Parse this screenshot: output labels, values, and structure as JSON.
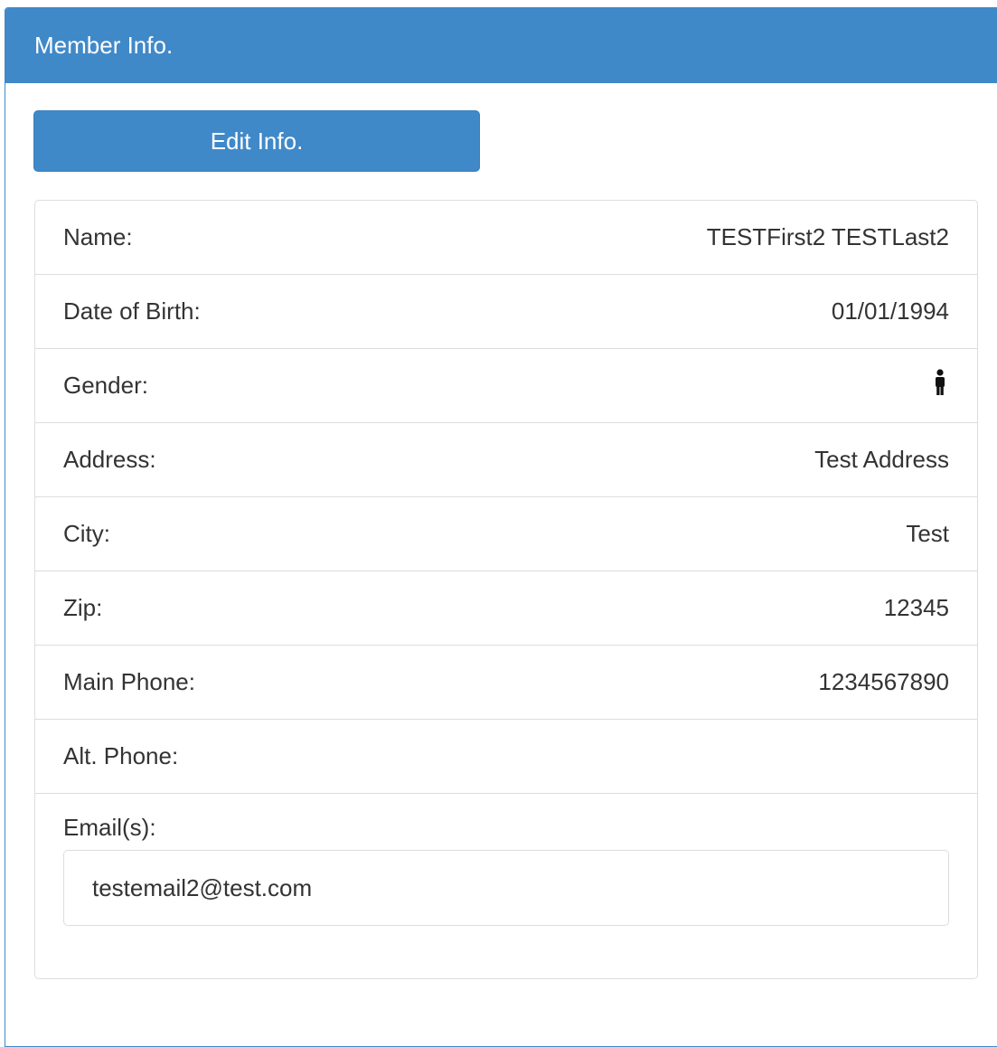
{
  "panel": {
    "title": "Member Info.",
    "edit_button_label": "Edit Info."
  },
  "details": {
    "name_label": "Name:",
    "name_value": "TESTFirst2 TESTLast2",
    "dob_label": "Date of Birth:",
    "dob_value": "01/01/1994",
    "gender_label": "Gender:",
    "gender_icon": "male-icon",
    "address_label": "Address:",
    "address_value": "Test Address",
    "city_label": "City:",
    "city_value": "Test",
    "zip_label": "Zip:",
    "zip_value": "12345",
    "main_phone_label": "Main Phone:",
    "main_phone_value": "1234567890",
    "alt_phone_label": "Alt. Phone:",
    "alt_phone_value": "",
    "emails_label": "Email(s):",
    "emails": [
      "testemail2@test.com"
    ]
  },
  "colors": {
    "primary": "#4089c9",
    "border": "#dddddd",
    "text": "#333333"
  }
}
